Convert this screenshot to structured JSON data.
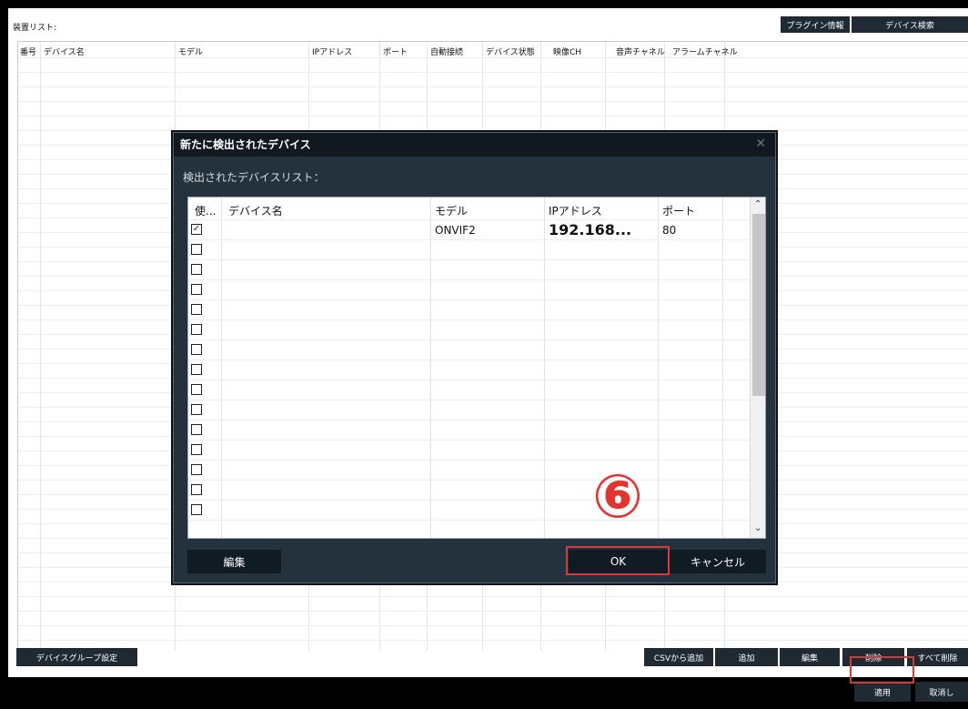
{
  "main": {
    "list_title": "装置リスト:",
    "top_buttons": {
      "plugin_info": "プラグイン情報",
      "device_search": "デバイス検索"
    },
    "columns": [
      "番号",
      "デバイス名",
      "モデル",
      "IPアドレス",
      "ポート",
      "自動接続",
      "デバイス状態",
      "映像CH",
      "音声チャネル",
      "アラームチャネル"
    ],
    "bottom_buttons": {
      "device_group": "デバイスグループ設定",
      "add_csv": "CSVから追加",
      "add": "追加",
      "edit": "編集",
      "delete": "削除",
      "delete_all": "すべて削除"
    }
  },
  "footer": {
    "apply": "適用",
    "cancel": "取消し"
  },
  "dialog": {
    "title": "新たに検出されたデバイス",
    "close_icon": "close-icon",
    "subtitle": "検出されたデバイスリスト：",
    "columns": [
      "使...",
      "デバイス名",
      "モデル",
      "IPアドレス",
      "ポート"
    ],
    "rows": [
      {
        "checked": true,
        "name": "",
        "model": "ONVIF2",
        "ip": "192.168...",
        "port": "80"
      },
      {
        "checked": false
      },
      {
        "checked": false
      },
      {
        "checked": false
      },
      {
        "checked": false
      },
      {
        "checked": false
      },
      {
        "checked": false
      },
      {
        "checked": false
      },
      {
        "checked": false
      },
      {
        "checked": false
      },
      {
        "checked": false
      },
      {
        "checked": false
      },
      {
        "checked": false
      },
      {
        "checked": false
      },
      {
        "checked": false
      }
    ],
    "edit_button": "編集",
    "ok_button": "OK",
    "cancel_button": "キャンセル"
  },
  "annotation": {
    "step_marker": "⑥",
    "highlight_color": "#d83a34"
  }
}
